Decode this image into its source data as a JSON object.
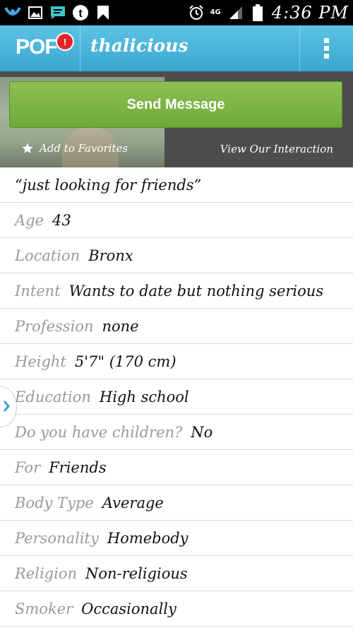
{
  "status_bar": {
    "time": "4:36 PM",
    "network": "4G"
  },
  "app_bar": {
    "logo": "POF",
    "notification_badge": "!",
    "username": "thalicious"
  },
  "header": {
    "send_message_label": "Send Message",
    "add_favorites_label": "Add to Favorites",
    "view_interaction_label": "View Our Interaction"
  },
  "profile": {
    "headline": "“just looking for friends”",
    "fields": [
      {
        "label": "Age",
        "value": "43"
      },
      {
        "label": "Location",
        "value": "Bronx"
      },
      {
        "label": "Intent",
        "value": "Wants to date but nothing serious"
      },
      {
        "label": "Profession",
        "value": "none"
      },
      {
        "label": "Height",
        "value": "5'7\" (170 cm)"
      },
      {
        "label": "Education",
        "value": "High school"
      },
      {
        "label": "Do you have children?",
        "value": "No"
      },
      {
        "label": "For",
        "value": "Friends"
      },
      {
        "label": "Body Type",
        "value": "Average"
      },
      {
        "label": "Personality",
        "value": "Homebody"
      },
      {
        "label": "Religion",
        "value": "Non-religious"
      },
      {
        "label": "Smoker",
        "value": "Occasionally"
      }
    ]
  },
  "colors": {
    "app_bar": "#46b3dc",
    "send_button": "#7db446",
    "header_bg": "#4d4d4d",
    "badge": "#e0262c"
  }
}
